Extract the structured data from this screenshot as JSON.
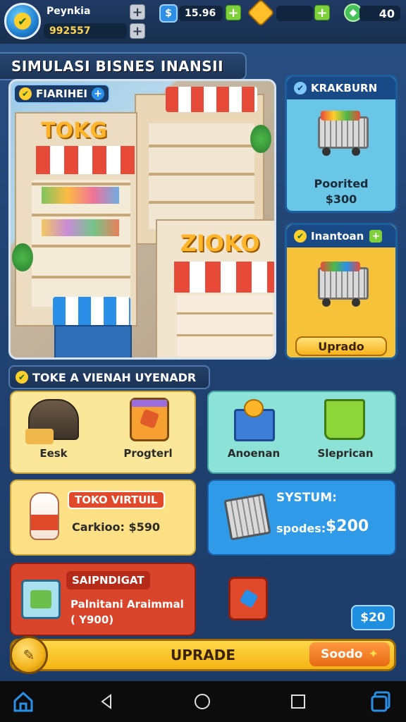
{
  "topbar": {
    "player_name": "Peynkia",
    "player_money": "992557",
    "currency_1": "15.96",
    "currency_2": "",
    "gems": "40"
  },
  "title": "SIMULASI BISNES INANSII",
  "scene": {
    "tag_label": "FIARIHEI",
    "sign_1": "TOKG",
    "sign_2": "ZIOKO"
  },
  "right_cards": [
    {
      "title": "KRAKBURN",
      "line1": "Poorited",
      "line2": "$300"
    },
    {
      "title": "Inantoan",
      "button": "Uprado"
    }
  ],
  "section_title": "TOKE A VIENAH UYENADR",
  "tiles_top": [
    {
      "label": "Eesk"
    },
    {
      "label": "Progterl"
    },
    {
      "label": "Anoenan"
    },
    {
      "label": "Sleprican"
    }
  ],
  "promo_left": {
    "title": "TOKO VIRTUIL",
    "line": "Carkioo: $590"
  },
  "promo_right": {
    "title": "SYSTUM:",
    "line_label": "spodes:",
    "line_value": "$200"
  },
  "red_card": {
    "title": "SAIPNDIGAT",
    "line1": "Palnitani Araimmal",
    "line2": "( Y900)"
  },
  "small_price": "$20",
  "upgrade_bar": {
    "label": "UPRADE",
    "right_label": "Soodo"
  },
  "colors": {
    "accent_yellow": "#f4b413",
    "accent_blue": "#1f8fe0",
    "accent_red": "#d9452b",
    "panel_bg": "#214373"
  }
}
